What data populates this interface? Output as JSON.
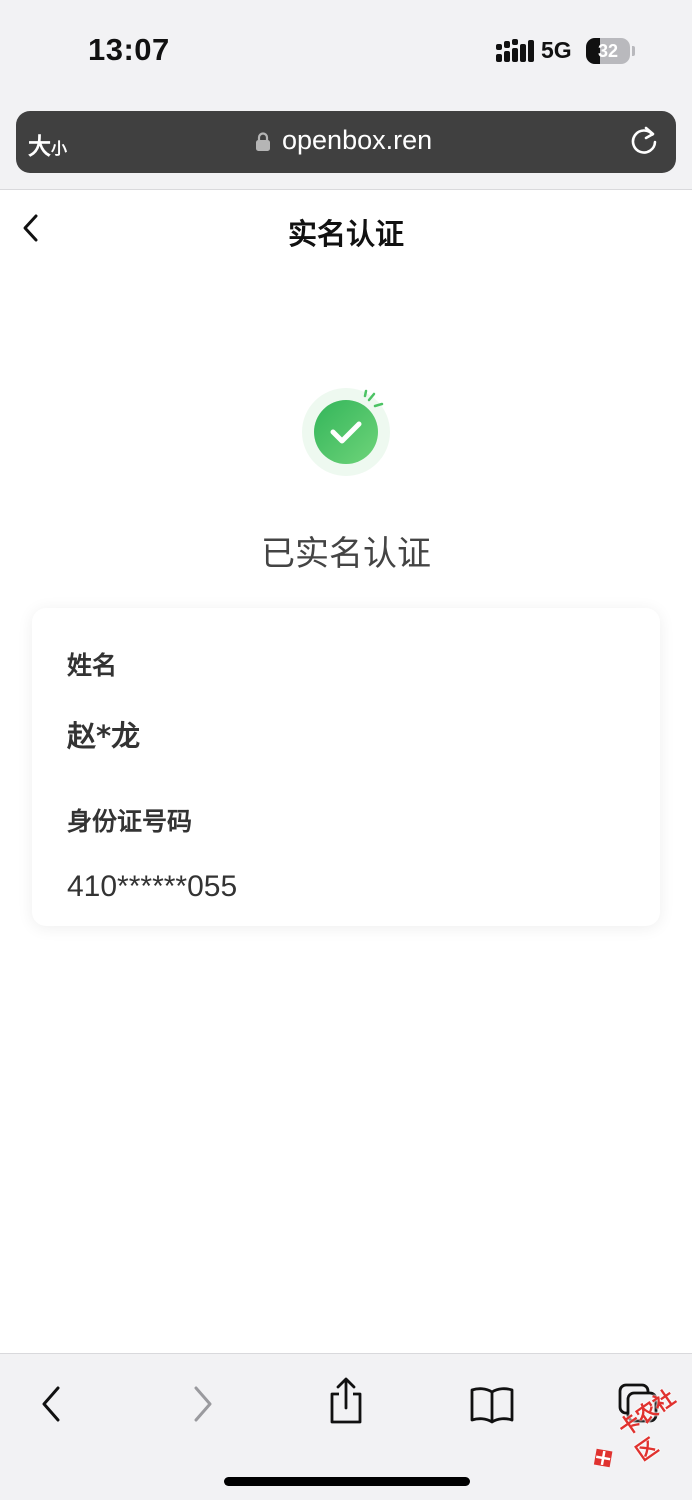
{
  "status_bar": {
    "time": "13:07",
    "network": "5G",
    "battery": "32",
    "battery_level": 0.32
  },
  "browser": {
    "text_size_big": "大",
    "text_size_small": "小",
    "url": "openbox.ren",
    "icons": [
      "lock-icon",
      "reload-icon"
    ]
  },
  "page": {
    "title": "实名认证",
    "status_text": "已实名认证",
    "accent_color": "#3dbd5f"
  },
  "card": {
    "name_label": "姓名",
    "name_value": "赵*龙",
    "id_label": "身份证号码",
    "id_value": "410******055"
  },
  "toolbar": {
    "items": [
      "back-icon",
      "forward-icon",
      "share-icon",
      "bookmarks-icon",
      "tabs-icon"
    ]
  },
  "watermark": {
    "text": "卡农社区"
  }
}
